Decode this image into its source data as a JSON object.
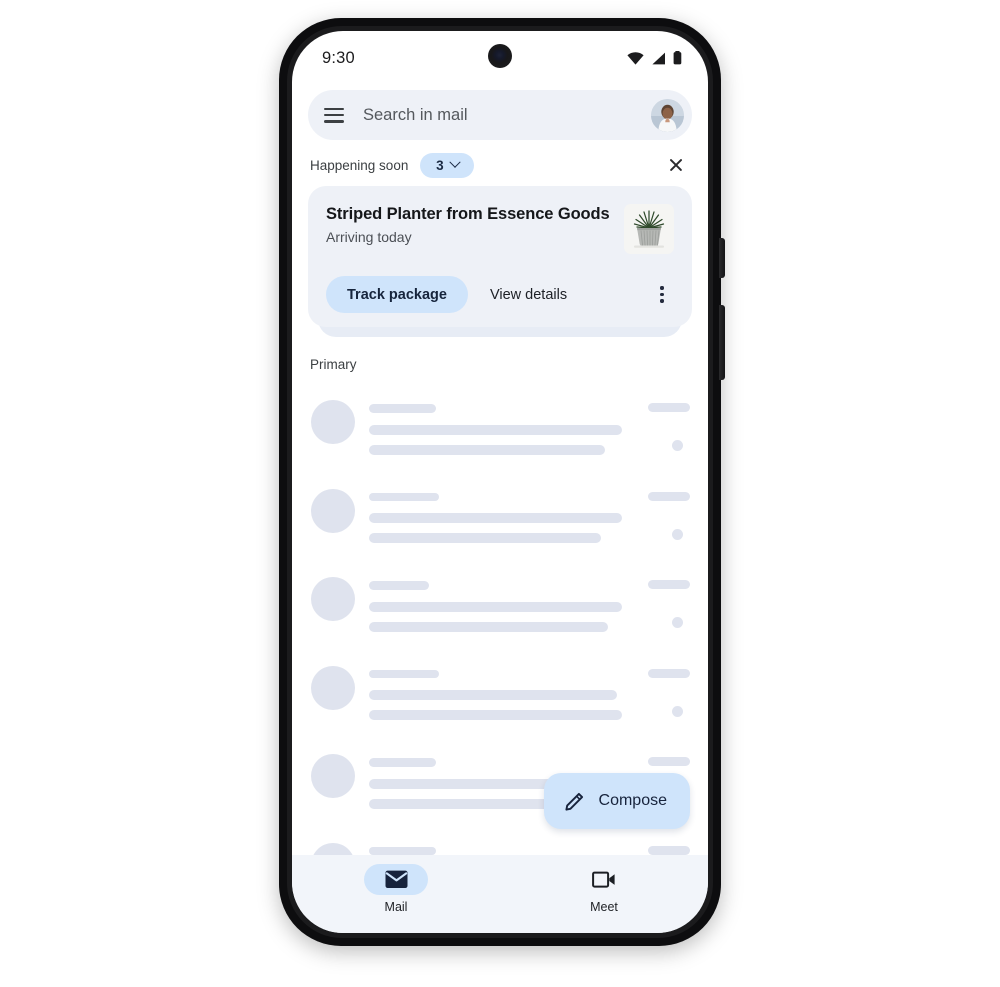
{
  "device": {
    "status_bar": {
      "time": "9:30",
      "icons": [
        "wifi-icon",
        "cell-signal-icon",
        "battery-icon"
      ]
    },
    "hardware": {
      "camera": "front-camera-punch-hole",
      "buttons": [
        "volume-button",
        "power-button"
      ]
    }
  },
  "app": {
    "search": {
      "menu_icon": "hamburger-menu-icon",
      "placeholder": "Search in mail",
      "avatar": "account-avatar"
    },
    "happening_soon": {
      "label": "Happening soon",
      "count": "3",
      "chevron_icon": "chevron-down-icon",
      "close_icon": "close-icon"
    },
    "package_card": {
      "title": "Striped Planter from Essence Goods",
      "subtitle": "Arriving today",
      "thumbnail": "striped-planter-product-image",
      "primary_action": "Track package",
      "secondary_action": "View details",
      "overflow_icon": "more-vert-icon"
    },
    "list": {
      "section_label": "Primary",
      "rows": [
        {
          "line1_width": 67,
          "line2_width": 253,
          "line3_width": 236,
          "time_width": 42
        },
        {
          "line1_width": 70,
          "line2_width": 253,
          "line3_width": 232,
          "time_width": 42
        },
        {
          "line1_width": 60,
          "line2_width": 253,
          "line3_width": 239,
          "time_width": 42
        },
        {
          "line1_width": 70,
          "line2_width": 248,
          "line3_width": 253,
          "time_width": 42
        },
        {
          "line1_width": 67,
          "line2_width": 253,
          "line3_width": 236,
          "time_width": 42
        },
        {
          "line1_width": 67,
          "line2_width": 253,
          "line3_width": 236,
          "time_width": 42
        }
      ]
    },
    "compose": {
      "label": "Compose",
      "icon": "pencil-edit-icon"
    },
    "bottom_nav": {
      "items": [
        {
          "label": "Mail",
          "icon": "envelope-icon",
          "active": true
        },
        {
          "label": "Meet",
          "icon": "video-camera-icon",
          "active": false
        }
      ]
    }
  },
  "colors": {
    "accent_blue": "#cfe4fb",
    "surface_light": "#eef1f7",
    "skeleton": "#dfe3ee",
    "nav_background": "#f2f5fa",
    "text_dark": "#15171a",
    "text_navy": "#16243c"
  }
}
